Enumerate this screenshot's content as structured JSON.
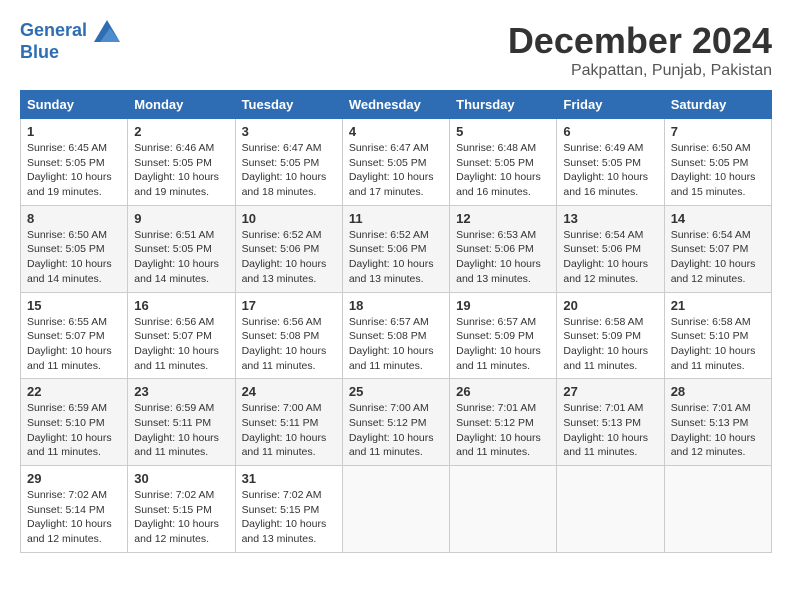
{
  "header": {
    "logo_line1": "General",
    "logo_line2": "Blue",
    "month_title": "December 2024",
    "location": "Pakpattan, Punjab, Pakistan"
  },
  "calendar": {
    "days_of_week": [
      "Sunday",
      "Monday",
      "Tuesday",
      "Wednesday",
      "Thursday",
      "Friday",
      "Saturday"
    ],
    "weeks": [
      [
        {
          "day": "1",
          "sunrise": "6:45 AM",
          "sunset": "5:05 PM",
          "daylight": "10 hours and 19 minutes."
        },
        {
          "day": "2",
          "sunrise": "6:46 AM",
          "sunset": "5:05 PM",
          "daylight": "10 hours and 19 minutes."
        },
        {
          "day": "3",
          "sunrise": "6:47 AM",
          "sunset": "5:05 PM",
          "daylight": "10 hours and 18 minutes."
        },
        {
          "day": "4",
          "sunrise": "6:47 AM",
          "sunset": "5:05 PM",
          "daylight": "10 hours and 17 minutes."
        },
        {
          "day": "5",
          "sunrise": "6:48 AM",
          "sunset": "5:05 PM",
          "daylight": "10 hours and 16 minutes."
        },
        {
          "day": "6",
          "sunrise": "6:49 AM",
          "sunset": "5:05 PM",
          "daylight": "10 hours and 16 minutes."
        },
        {
          "day": "7",
          "sunrise": "6:50 AM",
          "sunset": "5:05 PM",
          "daylight": "10 hours and 15 minutes."
        }
      ],
      [
        {
          "day": "8",
          "sunrise": "6:50 AM",
          "sunset": "5:05 PM",
          "daylight": "10 hours and 14 minutes."
        },
        {
          "day": "9",
          "sunrise": "6:51 AM",
          "sunset": "5:05 PM",
          "daylight": "10 hours and 14 minutes."
        },
        {
          "day": "10",
          "sunrise": "6:52 AM",
          "sunset": "5:06 PM",
          "daylight": "10 hours and 13 minutes."
        },
        {
          "day": "11",
          "sunrise": "6:52 AM",
          "sunset": "5:06 PM",
          "daylight": "10 hours and 13 minutes."
        },
        {
          "day": "12",
          "sunrise": "6:53 AM",
          "sunset": "5:06 PM",
          "daylight": "10 hours and 13 minutes."
        },
        {
          "day": "13",
          "sunrise": "6:54 AM",
          "sunset": "5:06 PM",
          "daylight": "10 hours and 12 minutes."
        },
        {
          "day": "14",
          "sunrise": "6:54 AM",
          "sunset": "5:07 PM",
          "daylight": "10 hours and 12 minutes."
        }
      ],
      [
        {
          "day": "15",
          "sunrise": "6:55 AM",
          "sunset": "5:07 PM",
          "daylight": "10 hours and 11 minutes."
        },
        {
          "day": "16",
          "sunrise": "6:56 AM",
          "sunset": "5:07 PM",
          "daylight": "10 hours and 11 minutes."
        },
        {
          "day": "17",
          "sunrise": "6:56 AM",
          "sunset": "5:08 PM",
          "daylight": "10 hours and 11 minutes."
        },
        {
          "day": "18",
          "sunrise": "6:57 AM",
          "sunset": "5:08 PM",
          "daylight": "10 hours and 11 minutes."
        },
        {
          "day": "19",
          "sunrise": "6:57 AM",
          "sunset": "5:09 PM",
          "daylight": "10 hours and 11 minutes."
        },
        {
          "day": "20",
          "sunrise": "6:58 AM",
          "sunset": "5:09 PM",
          "daylight": "10 hours and 11 minutes."
        },
        {
          "day": "21",
          "sunrise": "6:58 AM",
          "sunset": "5:10 PM",
          "daylight": "10 hours and 11 minutes."
        }
      ],
      [
        {
          "day": "22",
          "sunrise": "6:59 AM",
          "sunset": "5:10 PM",
          "daylight": "10 hours and 11 minutes."
        },
        {
          "day": "23",
          "sunrise": "6:59 AM",
          "sunset": "5:11 PM",
          "daylight": "10 hours and 11 minutes."
        },
        {
          "day": "24",
          "sunrise": "7:00 AM",
          "sunset": "5:11 PM",
          "daylight": "10 hours and 11 minutes."
        },
        {
          "day": "25",
          "sunrise": "7:00 AM",
          "sunset": "5:12 PM",
          "daylight": "10 hours and 11 minutes."
        },
        {
          "day": "26",
          "sunrise": "7:01 AM",
          "sunset": "5:12 PM",
          "daylight": "10 hours and 11 minutes."
        },
        {
          "day": "27",
          "sunrise": "7:01 AM",
          "sunset": "5:13 PM",
          "daylight": "10 hours and 11 minutes."
        },
        {
          "day": "28",
          "sunrise": "7:01 AM",
          "sunset": "5:13 PM",
          "daylight": "10 hours and 12 minutes."
        }
      ],
      [
        {
          "day": "29",
          "sunrise": "7:02 AM",
          "sunset": "5:14 PM",
          "daylight": "10 hours and 12 minutes."
        },
        {
          "day": "30",
          "sunrise": "7:02 AM",
          "sunset": "5:15 PM",
          "daylight": "10 hours and 12 minutes."
        },
        {
          "day": "31",
          "sunrise": "7:02 AM",
          "sunset": "5:15 PM",
          "daylight": "10 hours and 13 minutes."
        },
        null,
        null,
        null,
        null
      ]
    ]
  }
}
